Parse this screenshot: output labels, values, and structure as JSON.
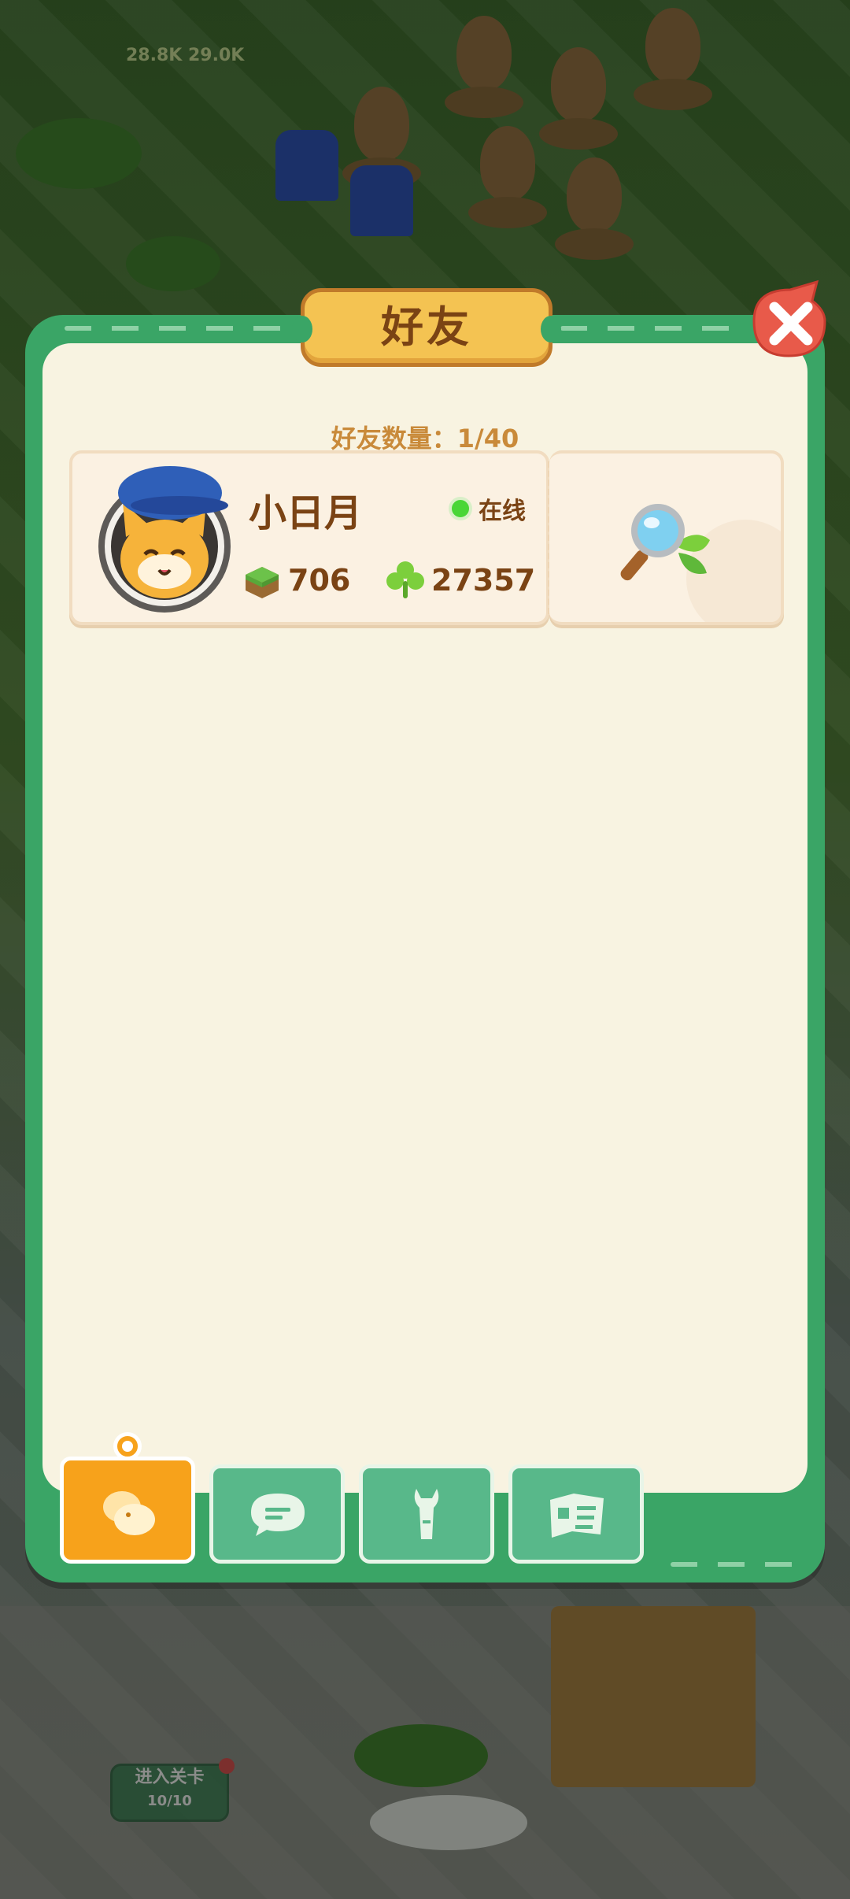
{
  "hud": {
    "leaf_values": "28.8K 29.0K"
  },
  "dialog": {
    "title": "好友",
    "friend_count_label": "好友数量：1/40"
  },
  "friends": [
    {
      "name": "小日月",
      "status": "在线",
      "land": "706",
      "clover": "27357"
    }
  ],
  "tabs": [
    {
      "icon": "chick-icon",
      "active": true
    },
    {
      "icon": "chat-bubble-icon",
      "active": false
    },
    {
      "icon": "wrench-icon",
      "active": false
    },
    {
      "icon": "book-icon",
      "active": false
    }
  ],
  "background": {
    "enter_level_label": "进入关卡",
    "enter_level_count": "10/10"
  },
  "colors": {
    "frame_green": "#3aa566",
    "panel_cream": "#f8f3e1",
    "title_gold": "#f4c352",
    "text_brown": "#7a4314",
    "online_green": "#49d637",
    "active_tab": "#f7a21b",
    "close_red": "#e85a4a"
  }
}
